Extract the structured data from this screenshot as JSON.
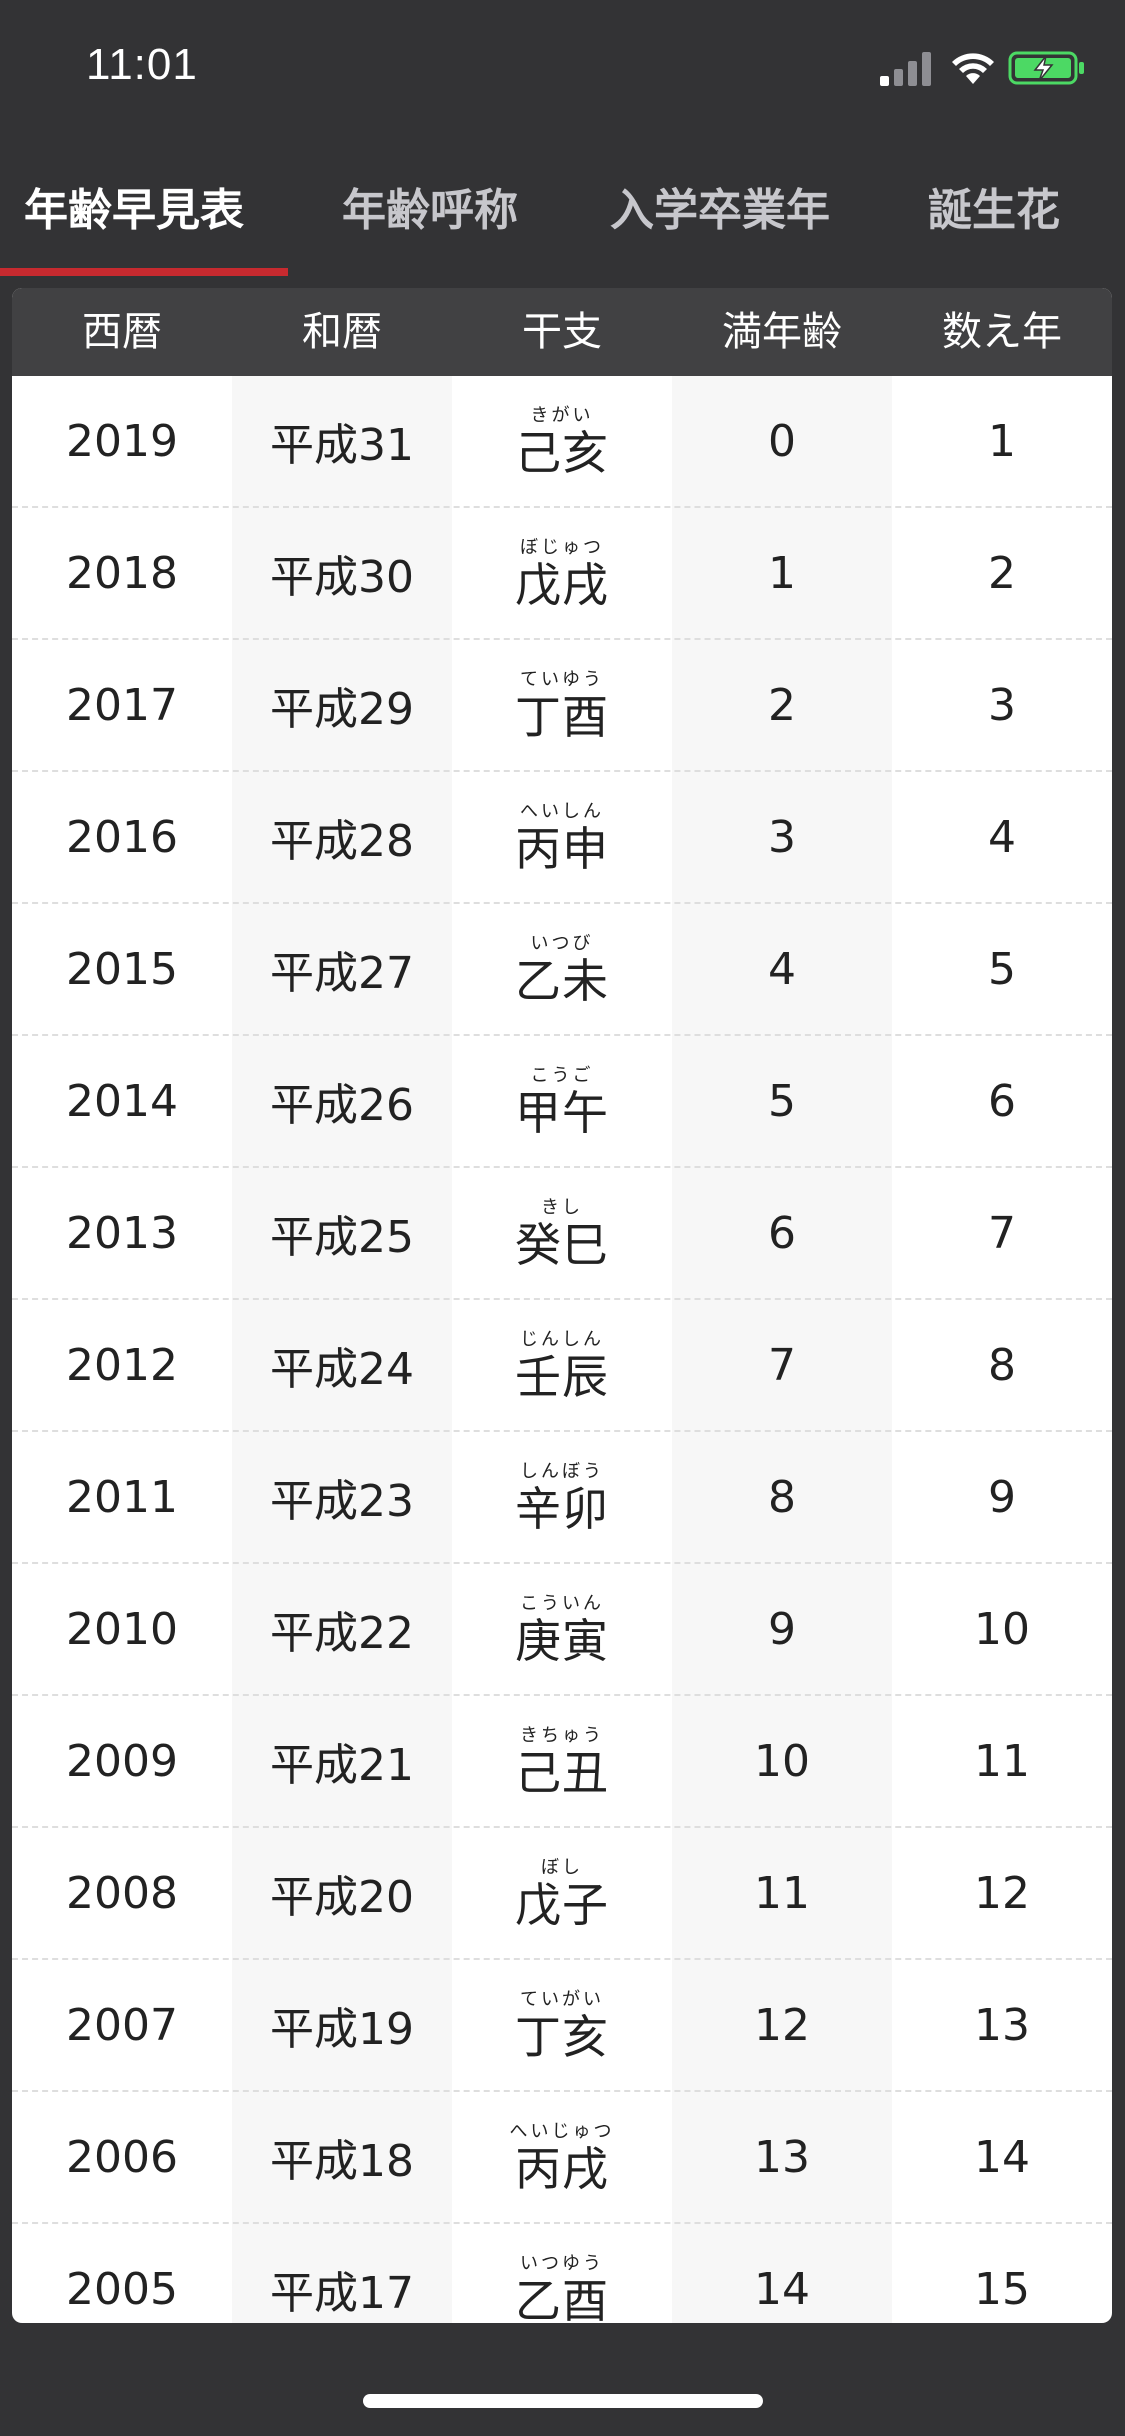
{
  "status_bar": {
    "time": "11:01",
    "icons": [
      "signal-icon",
      "wifi-icon",
      "battery-charging-icon"
    ],
    "battery_color": "#4cd964"
  },
  "tabs": [
    {
      "label": "年齢早見表",
      "active": true
    },
    {
      "label": "年齢呼称",
      "active": false
    },
    {
      "label": "入学卒業年",
      "active": false
    },
    {
      "label": "誕生花",
      "active": false
    }
  ],
  "accent_color": "#c72a2f",
  "table": {
    "headers": [
      "西暦",
      "和暦",
      "干支",
      "満年齢",
      "数え年"
    ],
    "rows": [
      {
        "year": "2019",
        "era": "平成31",
        "eto": "己亥",
        "ruby": "きがい",
        "age": "0",
        "kazoe": "1"
      },
      {
        "year": "2018",
        "era": "平成30",
        "eto": "戊戌",
        "ruby": "ぼじゅつ",
        "age": "1",
        "kazoe": "2"
      },
      {
        "year": "2017",
        "era": "平成29",
        "eto": "丁酉",
        "ruby": "ていゆう",
        "age": "2",
        "kazoe": "3"
      },
      {
        "year": "2016",
        "era": "平成28",
        "eto": "丙申",
        "ruby": "へいしん",
        "age": "3",
        "kazoe": "4"
      },
      {
        "year": "2015",
        "era": "平成27",
        "eto": "乙未",
        "ruby": "いつび",
        "age": "4",
        "kazoe": "5"
      },
      {
        "year": "2014",
        "era": "平成26",
        "eto": "甲午",
        "ruby": "こうご",
        "age": "5",
        "kazoe": "6"
      },
      {
        "year": "2013",
        "era": "平成25",
        "eto": "癸巳",
        "ruby": "きし",
        "age": "6",
        "kazoe": "7"
      },
      {
        "year": "2012",
        "era": "平成24",
        "eto": "壬辰",
        "ruby": "じんしん",
        "age": "7",
        "kazoe": "8"
      },
      {
        "year": "2011",
        "era": "平成23",
        "eto": "辛卯",
        "ruby": "しんぼう",
        "age": "8",
        "kazoe": "9"
      },
      {
        "year": "2010",
        "era": "平成22",
        "eto": "庚寅",
        "ruby": "こういん",
        "age": "9",
        "kazoe": "10"
      },
      {
        "year": "2009",
        "era": "平成21",
        "eto": "己丑",
        "ruby": "きちゅう",
        "age": "10",
        "kazoe": "11"
      },
      {
        "year": "2008",
        "era": "平成20",
        "eto": "戊子",
        "ruby": "ぼし",
        "age": "11",
        "kazoe": "12"
      },
      {
        "year": "2007",
        "era": "平成19",
        "eto": "丁亥",
        "ruby": "ていがい",
        "age": "12",
        "kazoe": "13"
      },
      {
        "year": "2006",
        "era": "平成18",
        "eto": "丙戌",
        "ruby": "へいじゅつ",
        "age": "13",
        "kazoe": "14"
      },
      {
        "year": "2005",
        "era": "平成17",
        "eto": "乙酉",
        "ruby": "いつゆう",
        "age": "14",
        "kazoe": "15"
      }
    ]
  }
}
